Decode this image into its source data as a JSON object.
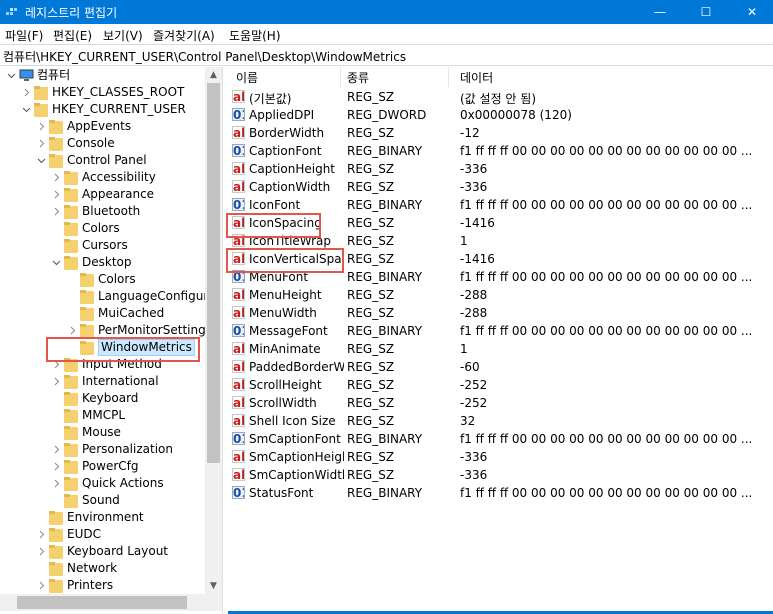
{
  "window": {
    "title": "레지스트리 편집기",
    "controls": [
      "—",
      "☐",
      "✕"
    ]
  },
  "menu": [
    "파일(F)",
    "편집(E)",
    "보기(V)",
    "즐겨찾기(A)",
    "도움말(H)"
  ],
  "address": "컴퓨터\\HKEY_CURRENT_USER\\Control Panel\\Desktop\\WindowMetrics",
  "tree": [
    {
      "label": "컴퓨터",
      "exp": "v"
    },
    {
      "label": "HKEY_CLASSES_ROOT",
      "exp": ">"
    },
    {
      "label": "HKEY_CURRENT_USER",
      "exp": "v"
    },
    {
      "label": "AppEvents",
      "exp": ">"
    },
    {
      "label": "Console",
      "exp": ">"
    },
    {
      "label": "Control Panel",
      "exp": "v"
    },
    {
      "label": "Accessibility",
      "exp": ">"
    },
    {
      "label": "Appearance",
      "exp": ">"
    },
    {
      "label": "Bluetooth",
      "exp": ">"
    },
    {
      "label": "Colors",
      "exp": ""
    },
    {
      "label": "Cursors",
      "exp": ""
    },
    {
      "label": "Desktop",
      "exp": "v"
    },
    {
      "label": "Colors",
      "exp": ""
    },
    {
      "label": "LanguageConfiguratio",
      "exp": ""
    },
    {
      "label": "MuiCached",
      "exp": ""
    },
    {
      "label": "PerMonitorSettings",
      "exp": ">"
    },
    {
      "label": "WindowMetrics",
      "exp": "",
      "selected": true
    },
    {
      "label": "Input Method",
      "exp": ">"
    },
    {
      "label": "International",
      "exp": ">"
    },
    {
      "label": "Keyboard",
      "exp": ""
    },
    {
      "label": "MMCPL",
      "exp": ""
    },
    {
      "label": "Mouse",
      "exp": ""
    },
    {
      "label": "Personalization",
      "exp": ">"
    },
    {
      "label": "PowerCfg",
      "exp": ">"
    },
    {
      "label": "Quick Actions",
      "exp": ">"
    },
    {
      "label": "Sound",
      "exp": ""
    },
    {
      "label": "Environment",
      "exp": ""
    },
    {
      "label": "EUDC",
      "exp": ">"
    },
    {
      "label": "Keyboard Layout",
      "exp": ">"
    },
    {
      "label": "Network",
      "exp": ""
    },
    {
      "label": "Printers",
      "exp": ">"
    }
  ],
  "columns": [
    "이름",
    "종류",
    "데이터"
  ],
  "values": [
    {
      "name": "(기본값)",
      "type": "REG_SZ",
      "data": "(값 설정 안 됨)",
      "kind": "str"
    },
    {
      "name": "AppliedDPI",
      "type": "REG_DWORD",
      "data": "0x00000078 (120)",
      "kind": "bin"
    },
    {
      "name": "BorderWidth",
      "type": "REG_SZ",
      "data": "-12",
      "kind": "str"
    },
    {
      "name": "CaptionFont",
      "type": "REG_BINARY",
      "data": "f1 ff ff ff 00 00 00 00 00 00 00 00 00 00 00 00 ...",
      "kind": "bin"
    },
    {
      "name": "CaptionHeight",
      "type": "REG_SZ",
      "data": "-336",
      "kind": "str"
    },
    {
      "name": "CaptionWidth",
      "type": "REG_SZ",
      "data": "-336",
      "kind": "str"
    },
    {
      "name": "IconFont",
      "type": "REG_BINARY",
      "data": "f1 ff ff ff 00 00 00 00 00 00 00 00 00 00 00 00 ...",
      "kind": "bin"
    },
    {
      "name": "IconSpacing",
      "type": "REG_SZ",
      "data": "-1416",
      "kind": "str"
    },
    {
      "name": "IconTitleWrap",
      "type": "REG_SZ",
      "data": "1",
      "kind": "str"
    },
    {
      "name": "IconVerticalSpa...",
      "type": "REG_SZ",
      "data": "-1416",
      "kind": "str"
    },
    {
      "name": "MenuFont",
      "type": "REG_BINARY",
      "data": "f1 ff ff ff 00 00 00 00 00 00 00 00 00 00 00 00 ...",
      "kind": "bin"
    },
    {
      "name": "MenuHeight",
      "type": "REG_SZ",
      "data": "-288",
      "kind": "str"
    },
    {
      "name": "MenuWidth",
      "type": "REG_SZ",
      "data": "-288",
      "kind": "str"
    },
    {
      "name": "MessageFont",
      "type": "REG_BINARY",
      "data": "f1 ff ff ff 00 00 00 00 00 00 00 00 00 00 00 00 ...",
      "kind": "bin"
    },
    {
      "name": "MinAnimate",
      "type": "REG_SZ",
      "data": "1",
      "kind": "str"
    },
    {
      "name": "PaddedBorderW...",
      "type": "REG_SZ",
      "data": "-60",
      "kind": "str"
    },
    {
      "name": "ScrollHeight",
      "type": "REG_SZ",
      "data": "-252",
      "kind": "str"
    },
    {
      "name": "ScrollWidth",
      "type": "REG_SZ",
      "data": "-252",
      "kind": "str"
    },
    {
      "name": "Shell Icon Size",
      "type": "REG_SZ",
      "data": "32",
      "kind": "str"
    },
    {
      "name": "SmCaptionFont",
      "type": "REG_BINARY",
      "data": "f1 ff ff ff 00 00 00 00 00 00 00 00 00 00 00 00 ...",
      "kind": "bin"
    },
    {
      "name": "SmCaptionHeight",
      "type": "REG_SZ",
      "data": "-336",
      "kind": "str"
    },
    {
      "name": "SmCaptionWidth",
      "type": "REG_SZ",
      "data": "-336",
      "kind": "str"
    },
    {
      "name": "StatusFont",
      "type": "REG_BINARY",
      "data": "f1 ff ff ff 00 00 00 00 00 00 00 00 00 00 00 00 ...",
      "kind": "bin"
    }
  ],
  "icons": {
    "str": "ab",
    "bin": "011"
  },
  "colors": {
    "titlebar": "#0078d7",
    "highlight": "#e2574c"
  }
}
